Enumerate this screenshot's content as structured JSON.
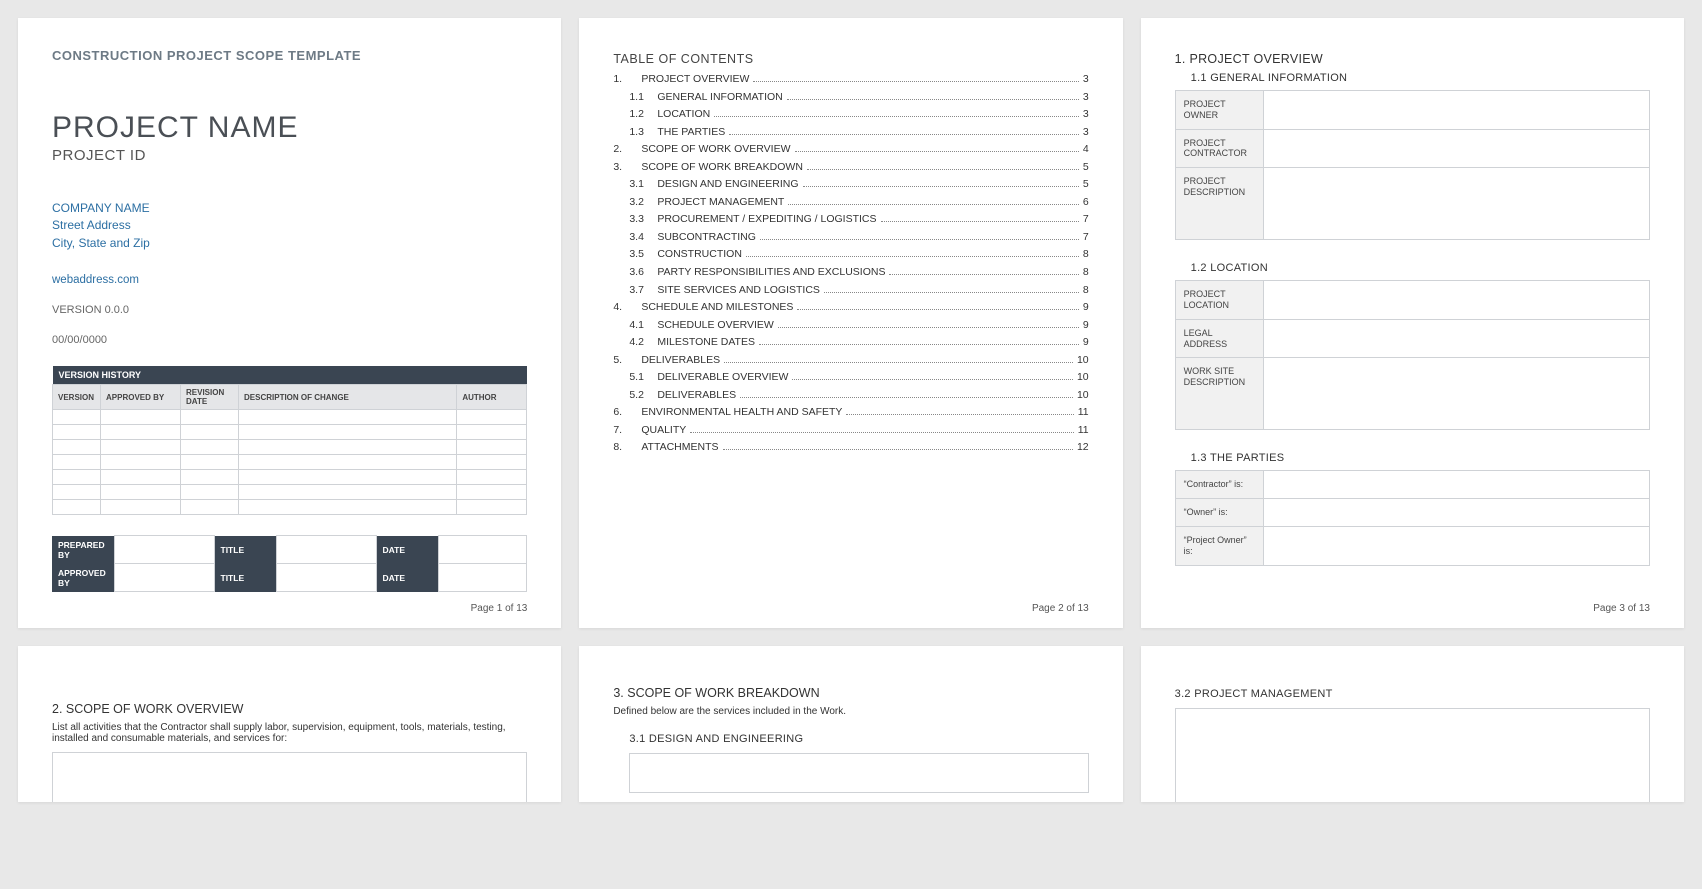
{
  "totalPages": 13,
  "page1": {
    "doc_title": "CONSTRUCTION PROJECT SCOPE TEMPLATE",
    "project_name": "PROJECT NAME",
    "project_id": "PROJECT ID",
    "company_name": "COMPANY NAME",
    "street": "Street Address",
    "city": "City, State and Zip",
    "web": "webaddress.com",
    "version": "VERSION 0.0.0",
    "date": "00/00/0000",
    "vhist_header": "VERSION HISTORY",
    "vhist_cols": [
      "VERSION",
      "APPROVED BY",
      "REVISION DATE",
      "DESCRIPTION OF CHANGE",
      "AUTHOR"
    ],
    "sign": {
      "prepared": "PREPARED BY",
      "approved": "APPROVED BY",
      "title": "TITLE",
      "date": "DATE"
    },
    "footer": "Page 1 of 13"
  },
  "page2": {
    "title": "TABLE OF CONTENTS",
    "items": [
      {
        "n": "1.",
        "t": "PROJECT OVERVIEW",
        "p": "3",
        "sub": false
      },
      {
        "n": "1.1",
        "t": "GENERAL INFORMATION",
        "p": "3",
        "sub": true
      },
      {
        "n": "1.2",
        "t": "LOCATION",
        "p": "3",
        "sub": true
      },
      {
        "n": "1.3",
        "t": "THE PARTIES",
        "p": "3",
        "sub": true
      },
      {
        "n": "2.",
        "t": "SCOPE OF WORK OVERVIEW",
        "p": "4",
        "sub": false
      },
      {
        "n": "3.",
        "t": "SCOPE OF WORK BREAKDOWN",
        "p": "5",
        "sub": false
      },
      {
        "n": "3.1",
        "t": "DESIGN AND ENGINEERING",
        "p": "5",
        "sub": true
      },
      {
        "n": "3.2",
        "t": "PROJECT MANAGEMENT",
        "p": "6",
        "sub": true
      },
      {
        "n": "3.3",
        "t": "PROCUREMENT / EXPEDITING / LOGISTICS",
        "p": "7",
        "sub": true
      },
      {
        "n": "3.4",
        "t": "SUBCONTRACTING",
        "p": "7",
        "sub": true
      },
      {
        "n": "3.5",
        "t": "CONSTRUCTION",
        "p": "8",
        "sub": true
      },
      {
        "n": "3.6",
        "t": "PARTY RESPONSIBILITIES AND EXCLUSIONS",
        "p": "8",
        "sub": true
      },
      {
        "n": "3.7",
        "t": "SITE SERVICES AND LOGISTICS",
        "p": "8",
        "sub": true
      },
      {
        "n": "4.",
        "t": "SCHEDULE AND MILESTONES",
        "p": "9",
        "sub": false
      },
      {
        "n": "4.1",
        "t": "SCHEDULE OVERVIEW",
        "p": "9",
        "sub": true
      },
      {
        "n": "4.2",
        "t": "MILESTONE DATES",
        "p": "9",
        "sub": true
      },
      {
        "n": "5.",
        "t": "DELIVERABLES",
        "p": "10",
        "sub": false
      },
      {
        "n": "5.1",
        "t": "DELIVERABLE OVERVIEW",
        "p": "10",
        "sub": true
      },
      {
        "n": "5.2",
        "t": "DELIVERABLES",
        "p": "10",
        "sub": true
      },
      {
        "n": "6.",
        "t": "ENVIRONMENTAL HEALTH AND SAFETY",
        "p": "11",
        "sub": false
      },
      {
        "n": "7.",
        "t": "QUALITY",
        "p": "11",
        "sub": false
      },
      {
        "n": "8.",
        "t": "ATTACHMENTS",
        "p": "12",
        "sub": false
      }
    ],
    "footer": "Page 2 of 13"
  },
  "page3": {
    "h1": "1.  PROJECT OVERVIEW",
    "s11": "1.1      GENERAL INFORMATION",
    "s11_rows": [
      "PROJECT OWNER",
      "PROJECT CONTRACTOR",
      "PROJECT DESCRIPTION"
    ],
    "s12": "1.2      LOCATION",
    "s12_rows": [
      "PROJECT LOCATION",
      "LEGAL ADDRESS",
      "WORK SITE DESCRIPTION"
    ],
    "s13": "1.3      THE PARTIES",
    "s13_rows": [
      "“Contractor” is:",
      "“Owner” is:",
      "“Project Owner” is:"
    ],
    "footer": "Page 3 of 13"
  },
  "page4": {
    "title": "2.  SCOPE OF WORK OVERVIEW",
    "desc": "List all activities that the Contractor shall supply labor, supervision, equipment, tools, materials, testing, installed and consumable materials, and services for:"
  },
  "page5": {
    "title": "3.  SCOPE OF WORK BREAKDOWN",
    "desc": "Defined below are the services included in the Work.",
    "sub": "3.1      DESIGN AND ENGINEERING"
  },
  "page6": {
    "sub": "3.2      PROJECT MANAGEMENT"
  }
}
